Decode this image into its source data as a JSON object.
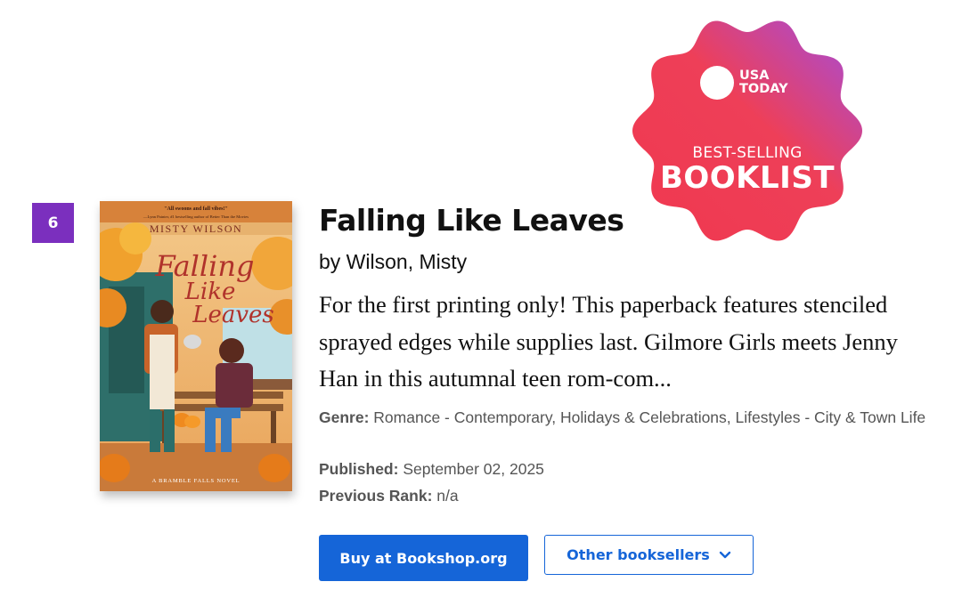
{
  "badge": {
    "brand": "USA TODAY",
    "line1": "BEST-SELLING",
    "line2": "BOOKLIST",
    "colors": {
      "start": "#f0384f",
      "end": "#a24de0"
    }
  },
  "book": {
    "rank": "6",
    "cover": {
      "quote": "\"All swoons and fall vibes!\"",
      "quote_attrib": "—Lynn Painter, #1 bestselling author of Better Than the Movies",
      "author": "MISTY WILSON",
      "title_line1": "Falling",
      "title_line2": "Like",
      "title_line3": "Leaves",
      "series": "A BRAMBLE FALLS NOVEL"
    },
    "title": "Falling Like Leaves",
    "author_line": "by Wilson, Misty",
    "description": "For the first printing only! This paperback features stenciled sprayed edges while supplies last. Gilmore Girls meets Jenny Han in this autumnal teen rom-com...",
    "genre_label": "Genre:",
    "genre": "Romance - Contemporary, Holidays & Celebrations, Lifestyles - City & Town Life",
    "published_label": "Published:",
    "published": "September 02, 2025",
    "previous_rank_label": "Previous Rank:",
    "previous_rank": "n/a"
  },
  "actions": {
    "buy_label": "Buy at Bookshop.org",
    "other_label": "Other booksellers"
  },
  "colors": {
    "rank_badge": "#7b2fbe",
    "primary": "#1565d8"
  }
}
